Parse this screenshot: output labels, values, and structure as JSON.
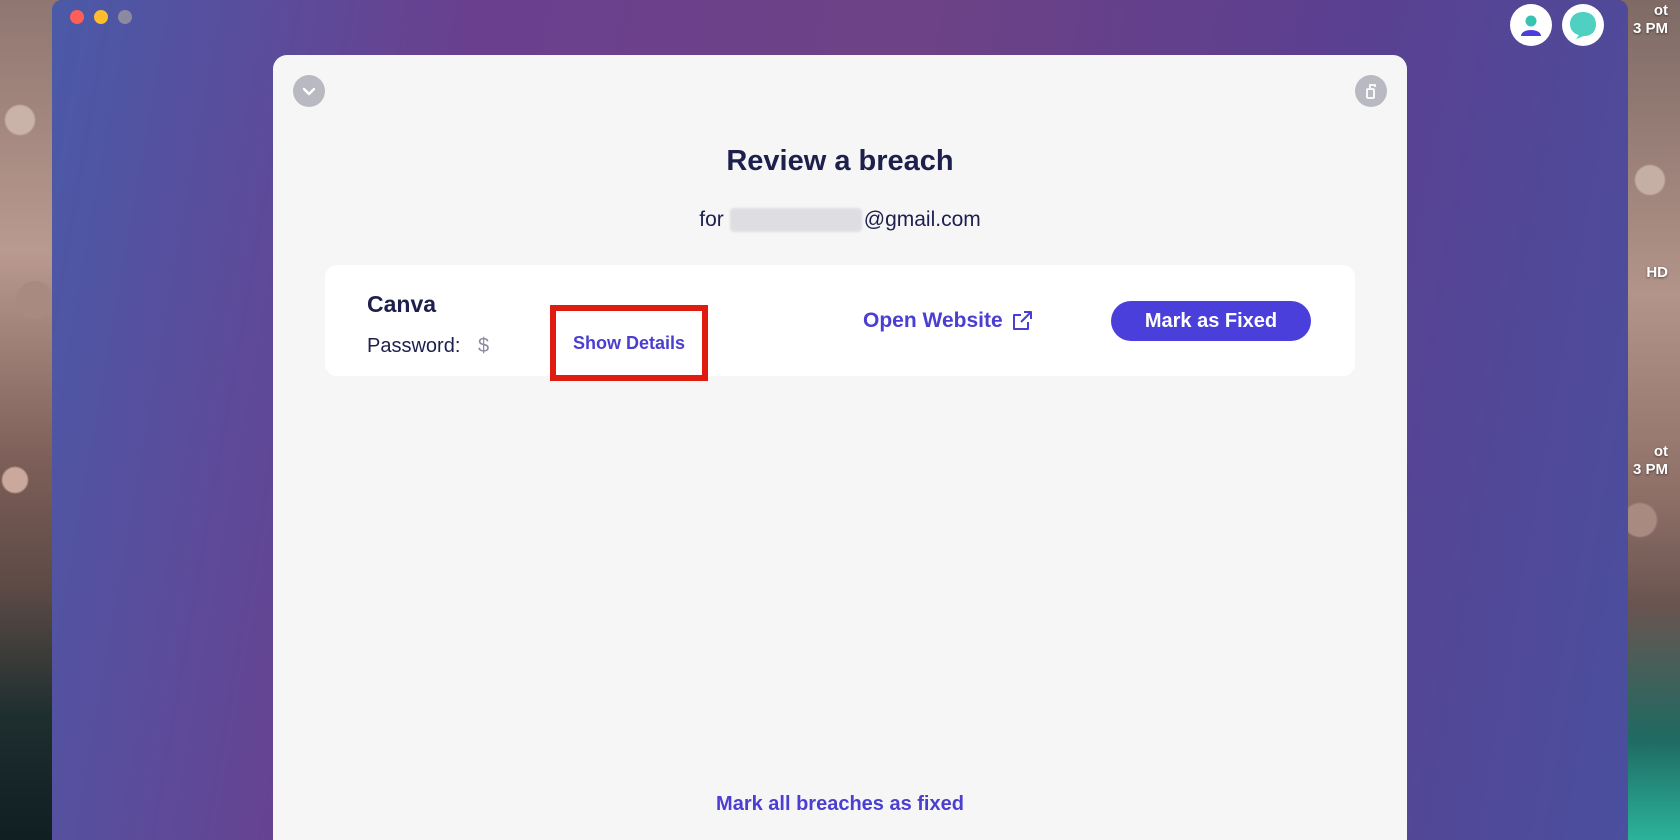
{
  "desktop": {
    "right_text_top": [
      "ot",
      "3 PM"
    ],
    "right_text_mid": "HD",
    "right_text_bottom": [
      "ot",
      "3 PM"
    ]
  },
  "panel": {
    "title": "Review a breach",
    "email_prefix": "for",
    "email_suffix": "@gmail.com"
  },
  "breach": {
    "name": "Canva",
    "password_label": "Password:",
    "password_value_partial": "$",
    "show_details_label": "Show Details",
    "open_website_label": "Open Website",
    "mark_fixed_label": "Mark as Fixed"
  },
  "footer": {
    "mark_all_label": "Mark all breaches as fixed"
  },
  "colors": {
    "accent": "#4a3fd0",
    "button_bg": "#4b3fdb",
    "highlight_border": "#e01b0f",
    "title": "#1d1f4d",
    "panel_bg": "#f6f6f6"
  },
  "icons": {
    "collapse": "chevron-down-icon",
    "copy": "copy-icon",
    "external": "external-link-icon",
    "profile": "user-avatar-icon",
    "chat": "chat-bubble-icon"
  }
}
